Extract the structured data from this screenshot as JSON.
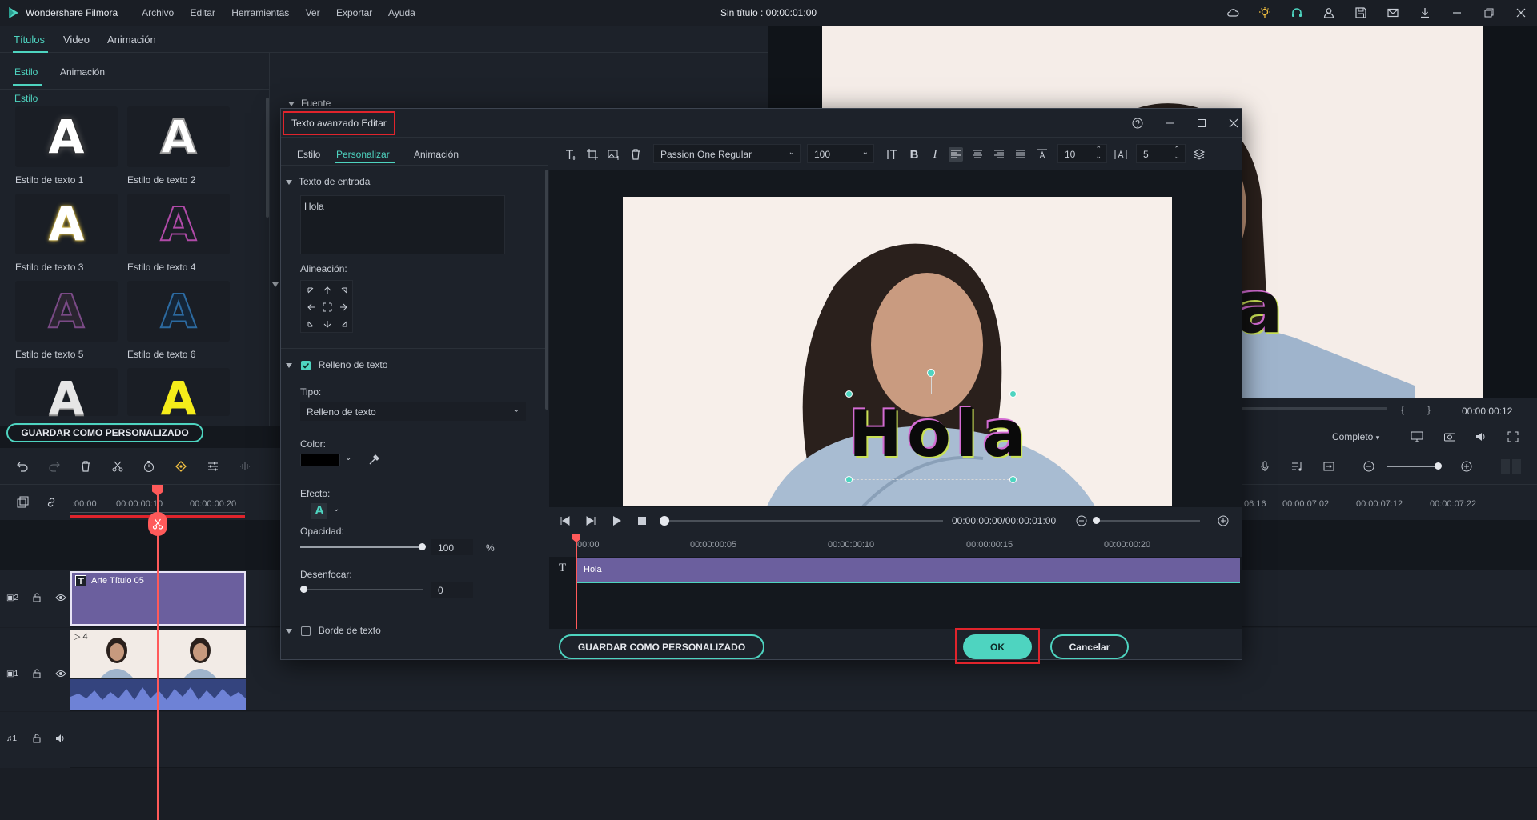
{
  "app": {
    "name": "Wondershare Filmora",
    "document_title": "Sin título : 00:00:01:00",
    "menu": [
      "Archivo",
      "Editar",
      "Herramientas",
      "Ver",
      "Exportar",
      "Ayuda"
    ]
  },
  "library": {
    "tabs": [
      "Títulos",
      "Video",
      "Animación"
    ],
    "subtabs": [
      "Estilo",
      "Animación"
    ],
    "section_font": "Fuente",
    "styles": [
      {
        "label": "Estilo de texto 1",
        "glyph": "A"
      },
      {
        "label": "Estilo de texto 2",
        "glyph": "A"
      },
      {
        "label": "Estilo de texto 3",
        "glyph": "A"
      },
      {
        "label": "Estilo de texto 4",
        "glyph": "A"
      },
      {
        "label": "Estilo de texto 5",
        "glyph": "A"
      },
      {
        "label": "Estilo de texto 6",
        "glyph": "A"
      },
      {
        "label": "",
        "glyph": "A"
      },
      {
        "label": "",
        "glyph": "A"
      }
    ],
    "save_custom": "GUARDAR COMO PERSONALIZADO"
  },
  "preview": {
    "overlay_text": "a",
    "brace_left": "{",
    "brace_right": "}",
    "timecode": "00:00:00:12",
    "quality": "Completo"
  },
  "timeline": {
    "ruler_left": [
      ":00:00",
      "00:00:00:10",
      "00:00:00:20"
    ],
    "ruler_right": [
      "06:16",
      "00:00:07:02",
      "00:00:07:12",
      "00:00:07:22"
    ],
    "tracks": [
      {
        "id": "2",
        "clip_label": "Arte Título 05"
      },
      {
        "id": "1",
        "clip_label": "4"
      },
      {
        "id": "1"
      }
    ]
  },
  "dialog": {
    "title": "Texto avanzado Editar",
    "tabs": [
      "Estilo",
      "Personalizar",
      "Animación"
    ],
    "input_section": "Texto de entrada",
    "input_text": "Hola",
    "alignment_label": "Alineación:",
    "fill_section": "Relleno de texto",
    "type_label": "Tipo:",
    "type_value": "Relleno de texto",
    "color_label": "Color:",
    "color_value": "#000000",
    "effect_label": "Efecto:",
    "effect_glyph": "A",
    "opacity_label": "Opacidad:",
    "opacity_value": "100",
    "opacity_unit": "%",
    "blur_label": "Desenfocar:",
    "blur_value": "0",
    "border_section": "Borde de texto",
    "font": "Passion One Regular",
    "font_size": "100",
    "line_spacing": "10",
    "char_spacing": "5",
    "canvas_text": "Hola",
    "player_time": "00:00:00:00/00:00:01:00",
    "ruler": [
      "00:00",
      "00:00:00:05",
      "00:00:00:10",
      "00:00:00:15",
      "00:00:00:20"
    ],
    "track_clip": "Hola",
    "save_custom": "GUARDAR COMO PERSONALIZADO",
    "ok": "OK",
    "cancel": "Cancelar"
  },
  "colors": {
    "accent": "#4ed4c0",
    "highlight": "#e0242c",
    "playhead": "#ff5a5a",
    "title_clip": "#6b5f9e"
  }
}
